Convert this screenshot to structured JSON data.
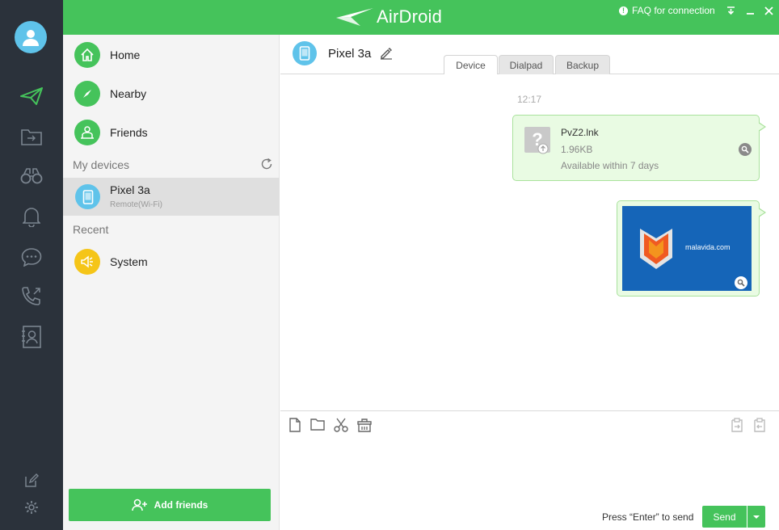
{
  "app": {
    "title": "AirDroid",
    "faq_label": "FAQ for connection",
    "colors": {
      "accent": "#45c35b",
      "rail": "#2b323b",
      "device": "#5fc3ea",
      "system": "#f5c518"
    }
  },
  "rail": {
    "items": [
      {
        "name": "avatar",
        "icon": "user-icon"
      },
      {
        "name": "transfer",
        "icon": "paper-plane-icon"
      },
      {
        "name": "files",
        "icon": "folder-transfer-icon"
      },
      {
        "name": "find-phone",
        "icon": "binoculars-icon"
      },
      {
        "name": "notifications",
        "icon": "bell-icon"
      },
      {
        "name": "messages",
        "icon": "chat-icon"
      },
      {
        "name": "calls",
        "icon": "phone-icon"
      },
      {
        "name": "contacts",
        "icon": "contact-card-icon"
      },
      {
        "name": "feedback",
        "icon": "edit-icon"
      },
      {
        "name": "settings",
        "icon": "gear-icon"
      }
    ]
  },
  "contacts": {
    "main_items": [
      {
        "label": "Home",
        "icon": "home-icon"
      },
      {
        "label": "Nearby",
        "icon": "compass-icon"
      },
      {
        "label": "Friends",
        "icon": "friends-icon"
      }
    ],
    "my_devices_label": "My devices",
    "device": {
      "name": "Pixel 3a",
      "status": "Remote(Wi-Fi)"
    },
    "recent_label": "Recent",
    "recent_items": [
      {
        "label": "System",
        "icon": "speaker-icon"
      }
    ],
    "add_friends_label": "Add friends"
  },
  "chat": {
    "device_name": "Pixel 3a",
    "tabs": [
      {
        "label": "Device",
        "active": true
      },
      {
        "label": "Dialpad",
        "active": false
      },
      {
        "label": "Backup",
        "active": false
      }
    ],
    "timestamp": "12:17",
    "file_message": {
      "name": "PvZ2.lnk",
      "size": "1.96KB",
      "note": "Available within 7 days"
    },
    "image_message": {
      "caption": "malavida.com"
    },
    "compose": {
      "hint": "Press “Enter” to send",
      "send_label": "Send"
    }
  }
}
